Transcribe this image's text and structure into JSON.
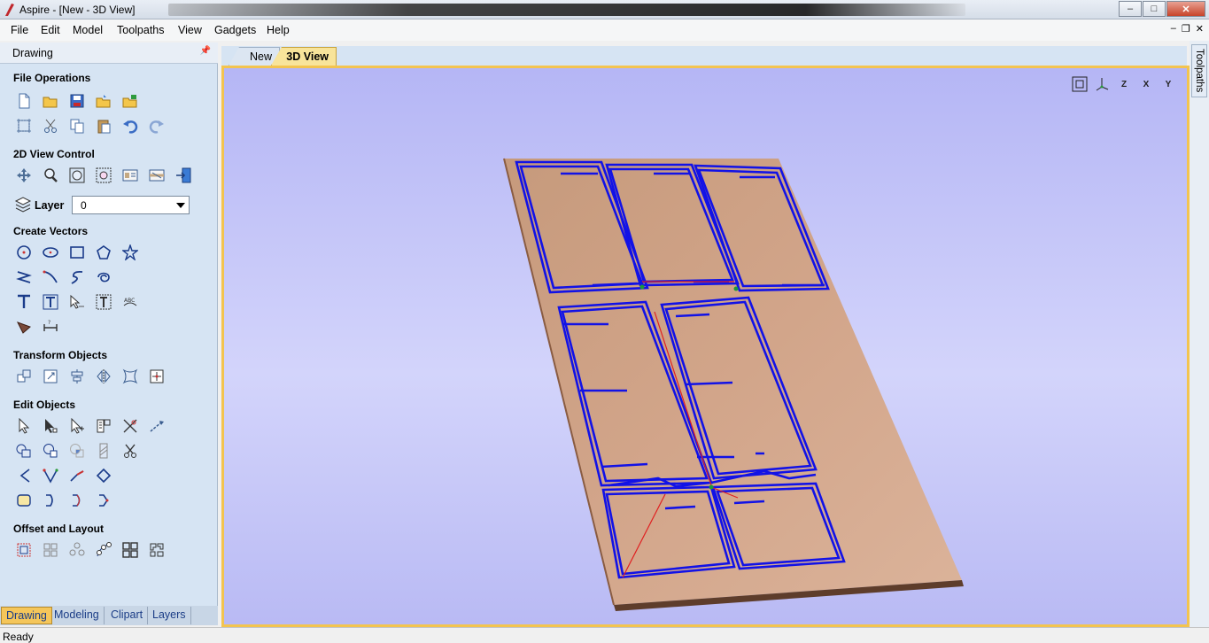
{
  "window": {
    "title": "Aspire - [New - 3D View]",
    "min": "–",
    "max": "□",
    "close": "✕"
  },
  "menu": {
    "items": [
      "File",
      "Edit",
      "Model",
      "Toolpaths",
      "View",
      "Gadgets",
      "Help"
    ],
    "mdi_min": "–",
    "mdi_restore": "❐",
    "mdi_close": "✕"
  },
  "panel": {
    "title": "Drawing",
    "pin": "📌",
    "sections": {
      "file_operations": "File Operations",
      "view_control": "2D View Control",
      "create_vectors": "Create Vectors",
      "transform_objects": "Transform Objects",
      "edit_objects": "Edit Objects",
      "offset_layout": "Offset and Layout"
    },
    "layer": {
      "label": "Layer",
      "value": "0"
    }
  },
  "bottom_tabs": [
    "Drawing",
    "Modeling",
    "Clipart",
    "Layers"
  ],
  "doc_tabs": [
    "New",
    "3D View"
  ],
  "right_tab": "Toolpaths",
  "view_icons": [
    "fit-icon",
    "iso-icon",
    "z-view-icon",
    "x-view-icon",
    "y-view-icon"
  ],
  "view_labels": {
    "z": "Z",
    "x": "X",
    "y": "Y"
  },
  "status": "Ready",
  "colors": {
    "accent": "#f3c44f",
    "toolpath": "#1010e0",
    "board": "#d7a98c"
  }
}
